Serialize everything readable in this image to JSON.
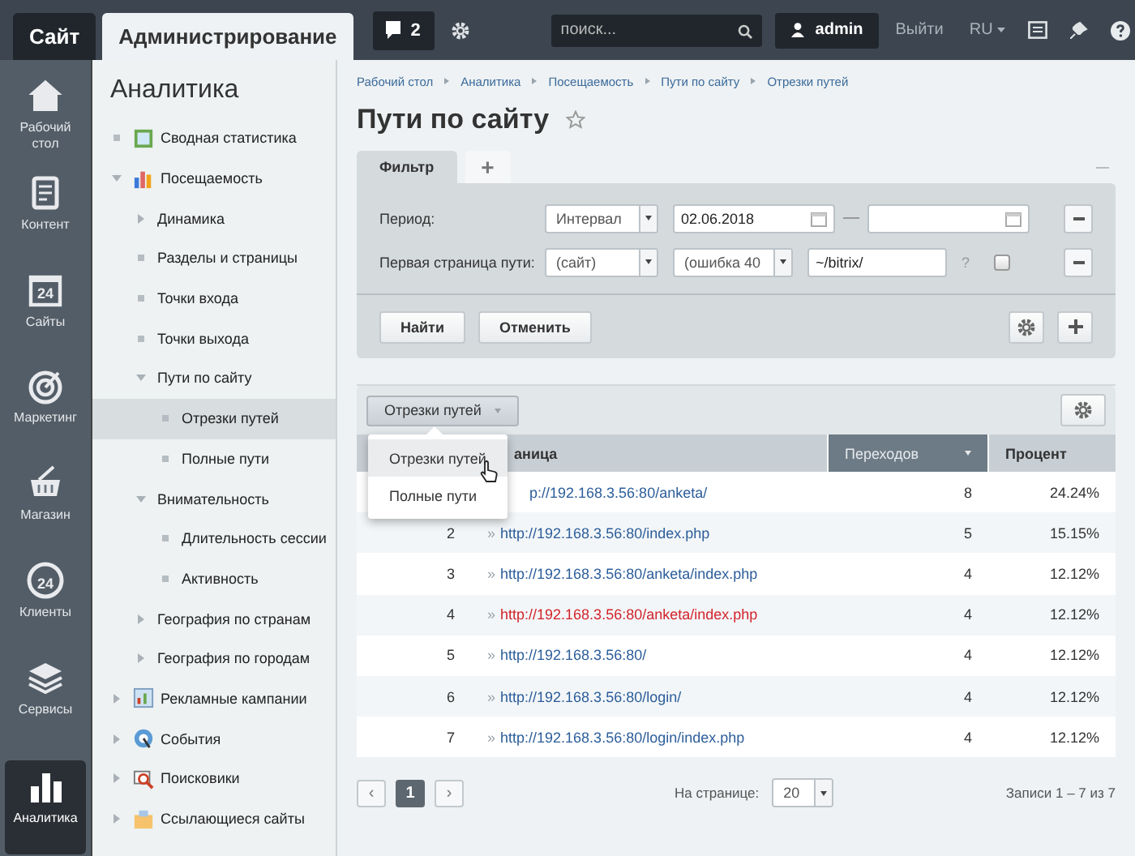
{
  "topbar": {
    "tabs": [
      {
        "label": "Сайт",
        "selected": false
      },
      {
        "label": "Администрирование",
        "selected": true
      }
    ],
    "notifications": "2",
    "search": {
      "placeholder": "поиск..."
    },
    "user": "admin",
    "logout": "Выйти",
    "language": "RU"
  },
  "rail": [
    {
      "label": "Рабочий стол",
      "selected": false
    },
    {
      "label": "Контент",
      "selected": false
    },
    {
      "label": "Сайты",
      "badge": "24",
      "selected": false
    },
    {
      "label": "Маркетинг",
      "selected": false
    },
    {
      "label": "Магазин",
      "selected": false
    },
    {
      "label": "Клиенты",
      "badge": "24",
      "selected": false
    },
    {
      "label": "Сервисы",
      "selected": false
    },
    {
      "label": "Аналитика",
      "selected": true
    }
  ],
  "nav": {
    "title": "Аналитика",
    "items": [
      {
        "label": "Сводная статистика",
        "kind": "leaf",
        "selected": false
      },
      {
        "label": "Посещаемость",
        "kind": "folder",
        "expanded": true,
        "selected": false,
        "children": [
          {
            "label": "Динамика",
            "kind": "folder",
            "expanded": false,
            "selected": false
          },
          {
            "label": "Разделы и страницы",
            "kind": "leaf",
            "selected": false
          },
          {
            "label": "Точки входа",
            "kind": "leaf",
            "selected": false
          },
          {
            "label": "Точки выхода",
            "kind": "leaf",
            "selected": false
          },
          {
            "label": "Пути по сайту",
            "kind": "folder",
            "expanded": true,
            "selected": false,
            "children": [
              {
                "label": "Отрезки путей",
                "kind": "leaf",
                "selected": true
              },
              {
                "label": "Полные пути",
                "kind": "leaf",
                "selected": false
              }
            ]
          },
          {
            "label": "Внимательность",
            "kind": "folder",
            "expanded": true,
            "selected": false,
            "children": [
              {
                "label": "Длительность сессии",
                "kind": "leaf",
                "selected": false
              },
              {
                "label": "Активность",
                "kind": "leaf",
                "selected": false
              }
            ]
          },
          {
            "label": "География по странам",
            "kind": "folder",
            "expanded": false,
            "selected": false
          },
          {
            "label": "География по городам",
            "kind": "folder",
            "expanded": false,
            "selected": false
          }
        ]
      },
      {
        "label": "Рекламные кампании",
        "kind": "folder",
        "expanded": false,
        "selected": false
      },
      {
        "label": "События",
        "kind": "folder",
        "expanded": false,
        "selected": false
      },
      {
        "label": "Поисковики",
        "kind": "folder",
        "expanded": false,
        "selected": false
      },
      {
        "label": "Ссылающиеся сайты",
        "kind": "folder",
        "expanded": false,
        "selected": false
      }
    ]
  },
  "breadcrumbs": [
    "Рабочий стол",
    "Аналитика",
    "Посещаемость",
    "Пути по сайту",
    "Отрезки путей"
  ],
  "page_title": "Пути по сайту",
  "filter": {
    "tabs": [
      {
        "label": "Фильтр",
        "selected": true
      },
      {
        "label": "+",
        "selected": false
      }
    ],
    "period": {
      "label": "Период:",
      "mode": "Интервал",
      "date_from": "02.06.2018"
    },
    "first_page": {
      "label": "Первая страница пути:",
      "site": "(сайт)",
      "status": "(ошибка 40",
      "value": "~/bitrix/",
      "hint": "?",
      "checked": false
    },
    "buttons": [
      "Найти",
      "Отменить"
    ]
  },
  "report": {
    "view": "Отрезки путей",
    "menu": [
      {
        "label": "Отрезки путей",
        "selected": true
      },
      {
        "label": "Полные пути",
        "selected": false
      }
    ],
    "columns": [
      {
        "label": "аница",
        "sorted": false
      },
      {
        "label": "Переходов",
        "sorted": true
      },
      {
        "label": "Процент",
        "sorted": false
      }
    ],
    "rows": [
      {
        "url": "p://192.168.3.56:80/anketa/",
        "visits": "8",
        "percent": "24.24%",
        "error": false
      },
      {
        "num": "2",
        "arrow": "»",
        "url": "http://192.168.3.56:80/index.php",
        "visits": "5",
        "percent": "15.15%",
        "error": false
      },
      {
        "num": "3",
        "arrow": "»",
        "url": "http://192.168.3.56:80/anketa/index.php",
        "visits": "4",
        "percent": "12.12%",
        "error": false
      },
      {
        "num": "4",
        "arrow": "»",
        "url": "http://192.168.3.56:80/anketa/index.php",
        "visits": "4",
        "percent": "12.12%",
        "error": true
      },
      {
        "num": "5",
        "arrow": "»",
        "url": "http://192.168.3.56:80/",
        "visits": "4",
        "percent": "12.12%",
        "error": false
      },
      {
        "num": "6",
        "arrow": "»",
        "url": "http://192.168.3.56:80/login/",
        "visits": "4",
        "percent": "12.12%",
        "error": false
      },
      {
        "num": "7",
        "arrow": "»",
        "url": "http://192.168.3.56:80/login/index.php",
        "visits": "4",
        "percent": "12.12%",
        "error": false
      }
    ]
  },
  "pager": {
    "prev": "‹",
    "pages": [
      {
        "label": "1",
        "selected": true
      }
    ],
    "next": "›",
    "per_page_label": "На странице:",
    "per_page": "20",
    "summary": "Записи 1 – 7 из 7"
  }
}
